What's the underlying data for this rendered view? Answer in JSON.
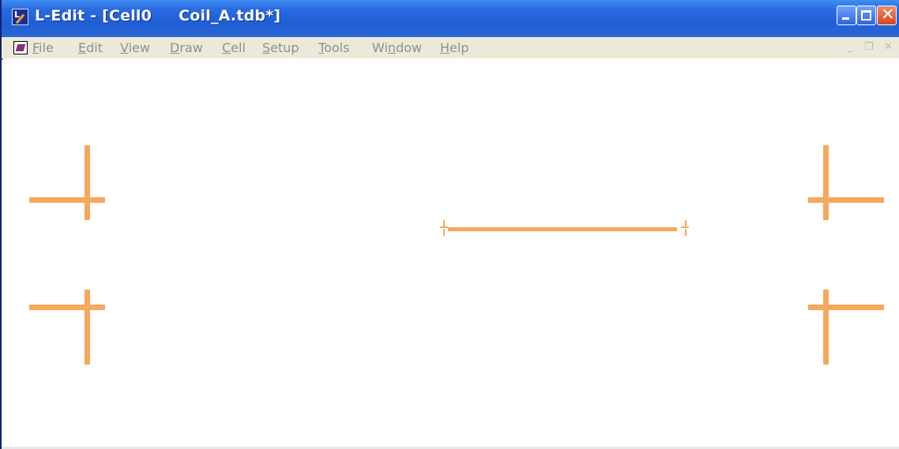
{
  "window": {
    "title": "L-Edit - [Cell0     Coil_A.tdb*]",
    "controls": {
      "close_glyph": "✕"
    }
  },
  "menubar": {
    "items": [
      "File",
      "Edit",
      "View",
      "Draw",
      "Cell",
      "Setup",
      "Tools",
      "Window",
      "Help"
    ],
    "mdi_controls": {
      "minimize": "_",
      "restore": "❐",
      "close": "✕"
    }
  },
  "canvas": {
    "background": "#ffffff",
    "layer_color": "#f6a85c",
    "shapes": [
      "alignment-mark",
      "alignment-mark",
      "alignment-mark",
      "alignment-mark",
      "coil-wire"
    ]
  }
}
